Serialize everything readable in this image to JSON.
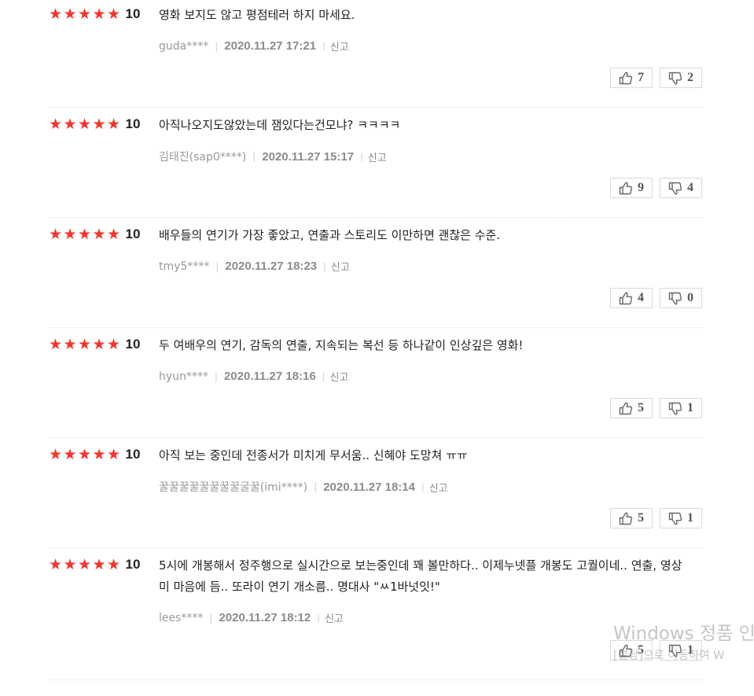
{
  "reviews": [
    {
      "score": "10",
      "text": "영화 보지도 않고 평점테러 하지 마세요.",
      "author": "guda****",
      "date": "2020.11.27 17:21",
      "report_label": "신고",
      "like": "7",
      "dislike": "2"
    },
    {
      "score": "10",
      "text": "아직나오지도않았는데 잼있다는건모냐? ㅋㅋㅋㅋ",
      "author": "김태진(sap0****)",
      "date": "2020.11.27 15:17",
      "report_label": "신고",
      "like": "9",
      "dislike": "4"
    },
    {
      "score": "10",
      "text": "배우들의 연기가 가장 좋았고, 연출과 스토리도 이만하면 괜찮은 수준.",
      "author": "tmy5****",
      "date": "2020.11.27 18:23",
      "report_label": "신고",
      "like": "4",
      "dislike": "0"
    },
    {
      "score": "10",
      "text": "두 여배우의 연기, 감독의 연출, 지속되는 복선 등 하나같이 인상깊은 영화!",
      "author": "hyun****",
      "date": "2020.11.27 18:16",
      "report_label": "신고",
      "like": "5",
      "dislike": "1"
    },
    {
      "score": "10",
      "text": "아직 보는 중인데 전종서가 미치게 무서움.. 신혜야 도망쳐 ㅠㅠ",
      "author": "꿀꿀꿀꿀꿀꿀꿀꿀굴꿀(imi****)",
      "date": "2020.11.27 18:14",
      "report_label": "신고",
      "like": "5",
      "dislike": "1"
    },
    {
      "score": "10",
      "text": "5시에 개봉해서 정주행으로 실시간으로 보는중인데 꽤 볼만하다.. 이제누넷플 개봉도 고퀄이네.. 연출, 영상미 마음에 듬.. 또라이 연기 개소름.. 명대사 \"ㅆ1바넛잇!\"",
      "author": "lees****",
      "date": "2020.11.27 18:12",
      "report_label": "신고",
      "like": "5",
      "dislike": "1"
    }
  ],
  "watermark": {
    "line1": "Windows 정품 인",
    "line2": "[설정]으로 이동하여 W"
  },
  "colors": {
    "star": "#f2352e",
    "border": "#d9d9d9"
  },
  "icons": {
    "like": "thumbs-up-icon",
    "dislike": "thumbs-down-icon",
    "star": "star-icon"
  }
}
